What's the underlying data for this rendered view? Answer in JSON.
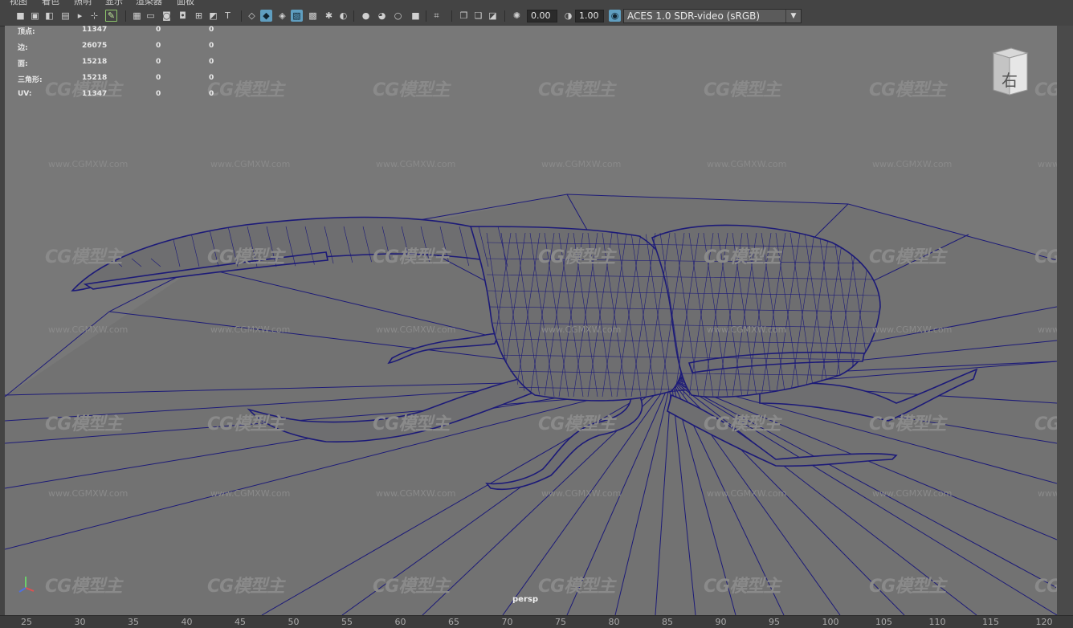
{
  "menubar": [
    "视图",
    "着色",
    "照明",
    "显示",
    "渲染器",
    "面板"
  ],
  "toolbar": {
    "exposure": "0.00",
    "gamma": "1.00",
    "colorspace": "ACES 1.0 SDR-video (sRGB)",
    "icons": [
      "camera-icon",
      "camera-attributes-icon",
      "bookmark-icon",
      "image-plane-icon",
      "bookmark-flag-icon",
      "grid-toggle-icon",
      "pencil-icon",
      "grid-icon",
      "film-gate-icon",
      "resolution-gate-icon",
      "gate-mask-icon",
      "field-chart-icon",
      "safe-action-icon",
      "safe-title-icon",
      "wireframe-icon",
      "smooth-shade-icon",
      "shaded-wireframe-icon",
      "wireframe-on-shaded-icon",
      "xray-icon",
      "lights-icon",
      "shadows-icon",
      "ambient-occlusion-icon",
      "motion-blur-icon",
      "anti-alias-icon",
      "depth-of-field-icon",
      "isolate-select-icon",
      "xray-joints-icon",
      "xray-active-icon",
      "backface-icon",
      "exposure-icon",
      "gamma-icon",
      "color-management-icon"
    ]
  },
  "hud": {
    "rows": [
      {
        "label": "顶点:",
        "v1": "11347",
        "v2": "0",
        "v3": "0"
      },
      {
        "label": "边:",
        "v1": "26075",
        "v2": "0",
        "v3": "0"
      },
      {
        "label": "面:",
        "v1": "15218",
        "v2": "0",
        "v3": "0"
      },
      {
        "label": "三角形:",
        "v1": "15218",
        "v2": "0",
        "v3": "0"
      },
      {
        "label": "UV:",
        "v1": "11347",
        "v2": "0",
        "v3": "0"
      }
    ]
  },
  "viewport": {
    "camera": "persp",
    "view_cube_label": "右",
    "watermark": "CG模型主",
    "watermark_url": "www.CGMXW.com",
    "colors": {
      "background": "#787878",
      "wire": "#1c1a78",
      "grid": "#1c1a78",
      "mesh_fill": "#6e6e70"
    }
  },
  "ruler": {
    "labels": [
      "25",
      "30",
      "35",
      "40",
      "45",
      "50",
      "55",
      "60",
      "65",
      "70",
      "75",
      "80",
      "85",
      "90",
      "95",
      "100",
      "105",
      "110",
      "115",
      "120"
    ]
  }
}
